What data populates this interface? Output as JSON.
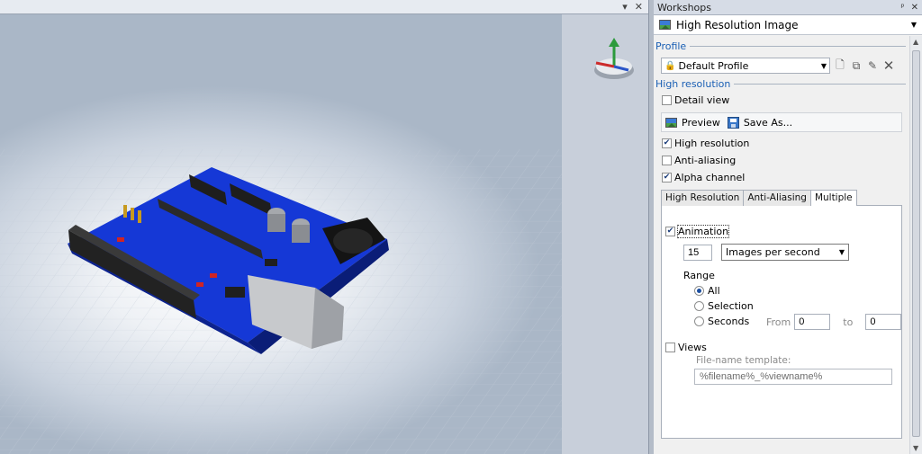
{
  "viewport": {
    "header_icons": [
      "▾",
      "✕"
    ]
  },
  "panel": {
    "title": "Workshops",
    "pin_icon": "pin-icon",
    "close_icon": "close-icon",
    "workshop": {
      "label": "High Resolution Image",
      "icon": "image-icon"
    },
    "profile_group": {
      "title": "Profile",
      "selected": "Default Profile"
    },
    "hires_group": {
      "title": "High resolution",
      "detail_view": {
        "label": "Detail view",
        "checked": false
      },
      "preview_label": "Preview",
      "save_as_label": "Save As...",
      "high_resolution": {
        "label": "High resolution",
        "checked": true
      },
      "anti_aliasing": {
        "label": "Anti-aliasing",
        "checked": false
      },
      "alpha_channel": {
        "label": "Alpha channel",
        "checked": true
      }
    },
    "tabs": [
      {
        "label": "High Resolution",
        "active": false
      },
      {
        "label": "Anti-Aliasing",
        "active": false
      },
      {
        "label": "Multiple",
        "active": true
      }
    ],
    "multiple": {
      "animation": {
        "label": "Animation",
        "checked": true
      },
      "rate_value": "15",
      "rate_unit": "Images per second",
      "range_label": "Range",
      "range_options": [
        {
          "label": "All",
          "selected": true
        },
        {
          "label": "Selection",
          "selected": false
        },
        {
          "label": "Seconds",
          "selected": false
        }
      ],
      "from_label": "From",
      "from_value": "0",
      "to_label": "to",
      "to_value": "0",
      "views": {
        "label": "Views",
        "checked": false
      },
      "template_label": "File-name template:",
      "template_value": "%filename%_%viewname%"
    }
  }
}
